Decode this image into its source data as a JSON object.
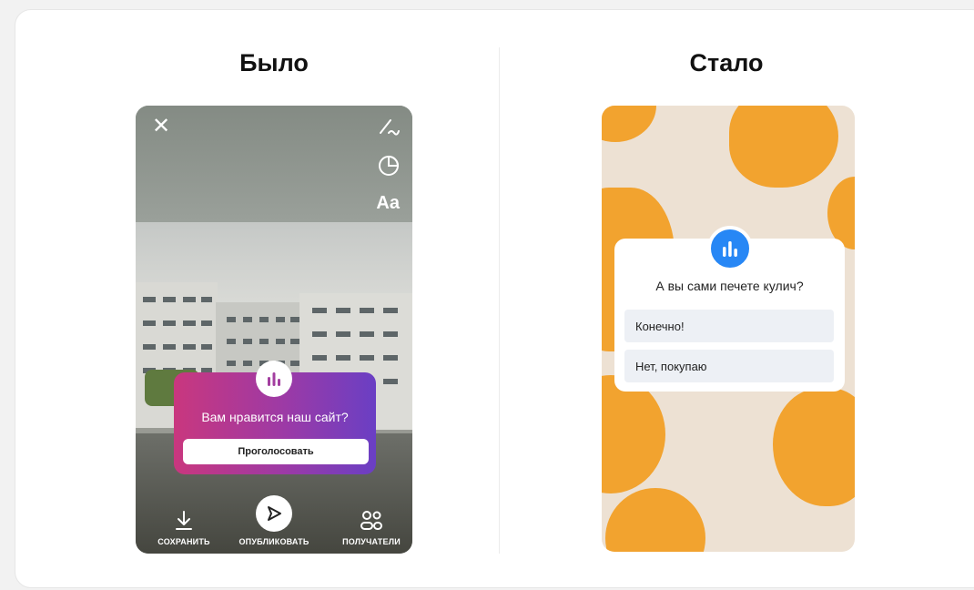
{
  "before": {
    "title": "Было",
    "tools": {
      "text_tool_label": "Aa"
    },
    "poll": {
      "question": "Вам нравится наш сайт?",
      "vote_label": "Проголосовать"
    },
    "bottom_bar": {
      "save_label": "СОХРАНИТЬ",
      "publish_label": "ОПУБЛИКОВАТЬ",
      "recipients_label": "ПОЛУЧАТЕЛИ"
    }
  },
  "after": {
    "title": "Стало",
    "poll": {
      "question": "А вы сами печете кулич?",
      "options": [
        "Конечно!",
        "Нет, покупаю"
      ]
    }
  },
  "colors": {
    "before_poll_gradient_start": "#c9377e",
    "before_poll_gradient_end": "#6a3fc4",
    "after_background": "#ede1d3",
    "after_blob": "#f2a32f",
    "after_poll_icon": "#2787f5"
  },
  "icons": {
    "close": "close-icon",
    "pen": "pen-icon",
    "sticker": "sticker-icon",
    "poll": "bar-chart-icon",
    "save": "download-icon",
    "publish": "send-icon",
    "recipients": "people-icon"
  }
}
